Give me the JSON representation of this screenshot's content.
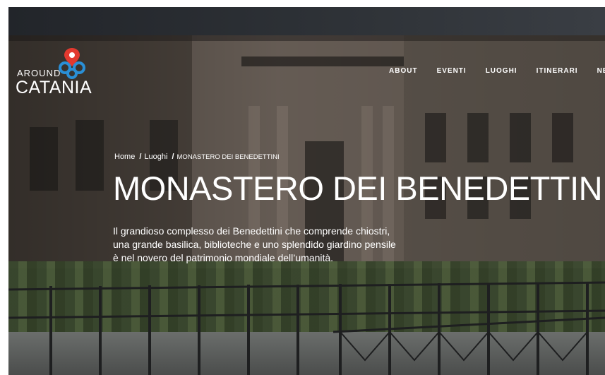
{
  "brand": {
    "around": "AROUND",
    "city": "CATANIA"
  },
  "nav": {
    "items": [
      "ABOUT",
      "EVENTI",
      "LUOGHI",
      "ITINERARI",
      "NEV"
    ]
  },
  "breadcrumb": {
    "home": "Home",
    "separator": "/",
    "section": "Luoghi",
    "current": "MONASTERO DEI BENEDETTINI"
  },
  "hero": {
    "title": "MONASTERO DEI BENEDETTINI",
    "description": "Il grandioso complesso dei Benedettini che comprende chiostri, una grande basilica, biblioteche e uno splendido giardino pensile è nel novero del patrimonio mondiale dell’umanità."
  },
  "colors": {
    "logo_red": "#e2392f",
    "logo_blue": "#2a8fd6",
    "text": "#ffffff"
  },
  "icons": {
    "logo": "map-pin-knot-icon"
  }
}
